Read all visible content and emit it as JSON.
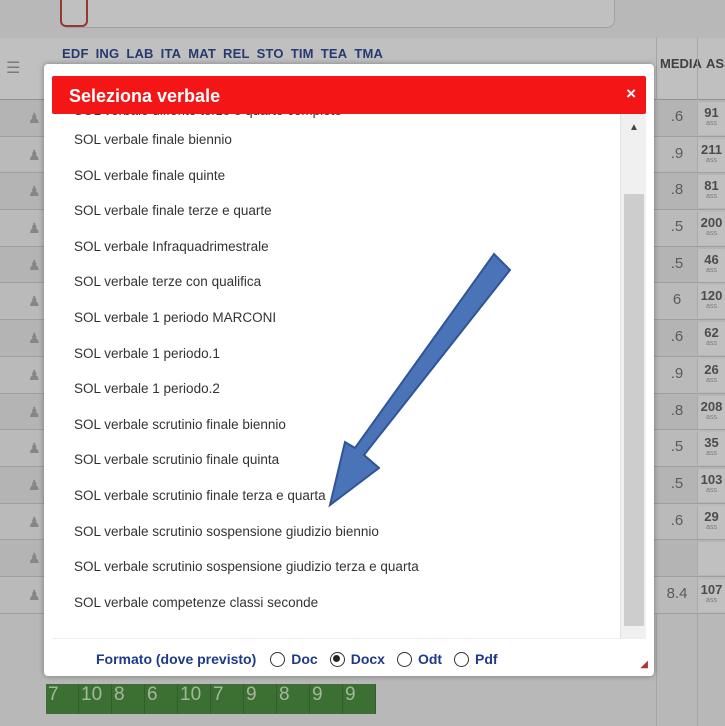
{
  "background": {
    "subjects": [
      "EDF",
      "ING",
      "LAB",
      "ITA",
      "MAT",
      "REL",
      "STO",
      "TIM",
      "TEA",
      "TMA"
    ],
    "media_header": "MEDIA",
    "ass_header": "ASS",
    "rows": [
      {
        "media": ".6",
        "ass": "91",
        "ass_sub": "ass"
      },
      {
        "media": ".9",
        "ass": "211",
        "ass_sub": "ass"
      },
      {
        "media": ".8",
        "ass": "81",
        "ass_sub": "ass"
      },
      {
        "media": ".5",
        "ass": "200",
        "ass_sub": "ass"
      },
      {
        "media": ".5",
        "ass": "46",
        "ass_sub": "ass"
      },
      {
        "media": "6",
        "ass": "120",
        "ass_sub": "ass"
      },
      {
        "media": ".6",
        "ass": "62",
        "ass_sub": "ass"
      },
      {
        "media": ".9",
        "ass": "26",
        "ass_sub": "ass"
      },
      {
        "media": ".8",
        "ass": "208",
        "ass_sub": "ass"
      },
      {
        "media": ".5",
        "ass": "35",
        "ass_sub": "ass"
      },
      {
        "media": ".5",
        "ass": "103",
        "ass_sub": "ass"
      },
      {
        "media": ".6",
        "ass": "29",
        "ass_sub": "ass"
      },
      {
        "media": "",
        "ass": "",
        "ass_sub": ""
      },
      {
        "media": "8.4",
        "ass": "107",
        "ass_sub": "ass"
      }
    ],
    "bottom_grades": [
      "7",
      "10",
      "8",
      "6",
      "10",
      "7",
      "9",
      "8",
      "9",
      "9"
    ]
  },
  "modal": {
    "title": "Seleziona verbale",
    "close_label": "×",
    "items": [
      "SOL verbale differito terze e quarte completo",
      "SOL verbale finale biennio",
      "SOL verbale finale quinte",
      "SOL verbale finale terze e quarte",
      "SOL verbale Infraquadrimestrale",
      "SOL verbale terze con qualifica",
      "SOL verbale 1 periodo MARCONI",
      "SOL verbale 1 periodo.1",
      "SOL verbale 1 periodo.2",
      "SOL verbale scrutinio finale biennio",
      "SOL verbale scrutinio finale quinta",
      "SOL verbale scrutinio finale terza e quarta",
      "SOL verbale scrutinio sospensione giudizio biennio",
      "SOL verbale scrutinio sospensione giudizio terza e quarta",
      "SOL verbale competenze classi seconde"
    ],
    "format_label": "Formato (dove previsto)",
    "formats": [
      {
        "label": "Doc",
        "selected": false
      },
      {
        "label": "Docx",
        "selected": true
      },
      {
        "label": "Odt",
        "selected": false
      },
      {
        "label": "Pdf",
        "selected": false
      }
    ]
  },
  "annotation": {
    "arrow_color": "#4a73b8",
    "arrow_stroke": "#2f5597"
  }
}
